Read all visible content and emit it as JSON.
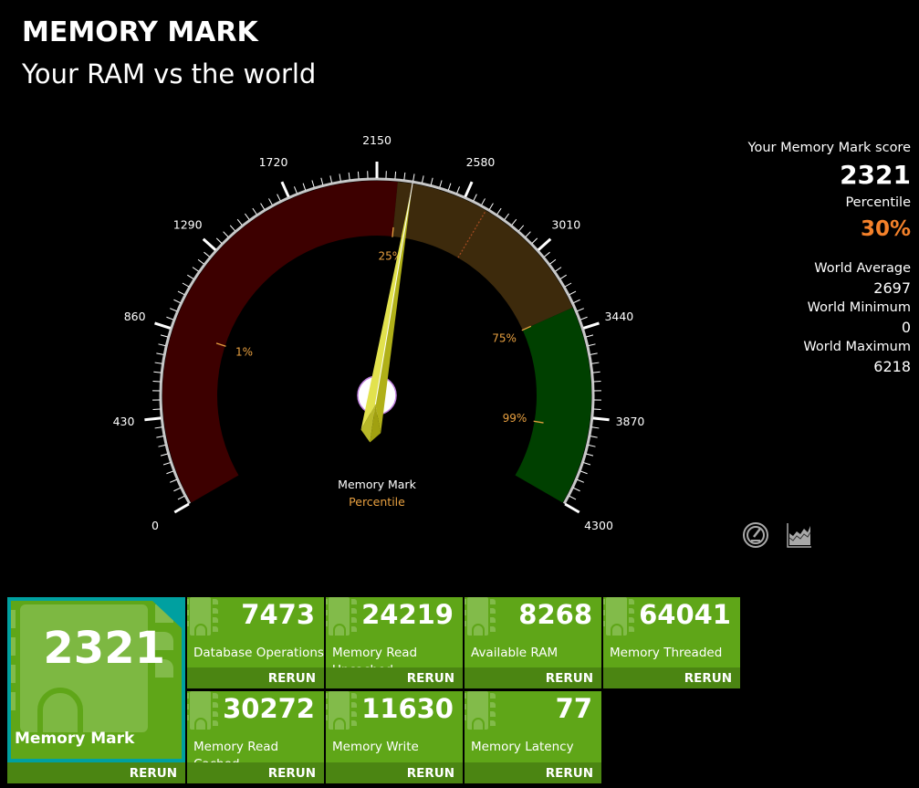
{
  "header": {
    "title": "MEMORY MARK",
    "subtitle": "Your RAM vs the world"
  },
  "gauge": {
    "min": 0,
    "max": 4300,
    "major_ticks": [
      "0",
      "430",
      "860",
      "1290",
      "1720",
      "2150",
      "2580",
      "3010",
      "3440",
      "3870",
      "4300"
    ],
    "minor_per_major": 10,
    "needle_value": 2321,
    "world_average_value": 2697,
    "bands": [
      {
        "from": 0,
        "to": 2250,
        "color": "#3d0000"
      },
      {
        "from": 2250,
        "to": 3330,
        "color": "#3d2a0c"
      },
      {
        "from": 3330,
        "to": 4300,
        "color": "#004000"
      }
    ],
    "percentile_markers": [
      {
        "label": "1%",
        "value": 860
      },
      {
        "label": "25%",
        "value": 2250
      },
      {
        "label": "75%",
        "value": 3330
      },
      {
        "label": "99%",
        "value": 3930
      }
    ],
    "center_label": "Memory Mark",
    "center_sublabel": "Percentile",
    "colors": {
      "needle": "#d8d840",
      "marker": "#e8a040",
      "scale": "#c8c8c8"
    }
  },
  "summary": {
    "score_label": "Your Memory Mark score",
    "score": "2321",
    "percentile_label": "Percentile",
    "percentile": "30%",
    "world_average_label": "World Average",
    "world_average": "2697",
    "world_minimum_label": "World Minimum",
    "world_minimum": "0",
    "world_maximum_label": "World Maximum",
    "world_maximum": "6218"
  },
  "icons": {
    "gauge_view": "gauge-icon",
    "chart_view": "area-chart-icon"
  },
  "tiles": {
    "main": {
      "value": "2321",
      "label": "Memory Mark",
      "action": "RERUN"
    },
    "items": [
      {
        "value": "7473",
        "label": "Database Operations",
        "action": "RERUN"
      },
      {
        "value": "24219",
        "label": "Memory Read Uncached",
        "action": "RERUN"
      },
      {
        "value": "8268",
        "label": "Available RAM",
        "action": "RERUN"
      },
      {
        "value": "64041",
        "label": "Memory Threaded",
        "action": "RERUN"
      },
      {
        "value": "30272",
        "label": "Memory Read Cached",
        "action": "RERUN"
      },
      {
        "value": "11630",
        "label": "Memory Write",
        "action": "RERUN"
      },
      {
        "value": "77",
        "label": "Memory Latency",
        "action": "RERUN"
      }
    ]
  }
}
